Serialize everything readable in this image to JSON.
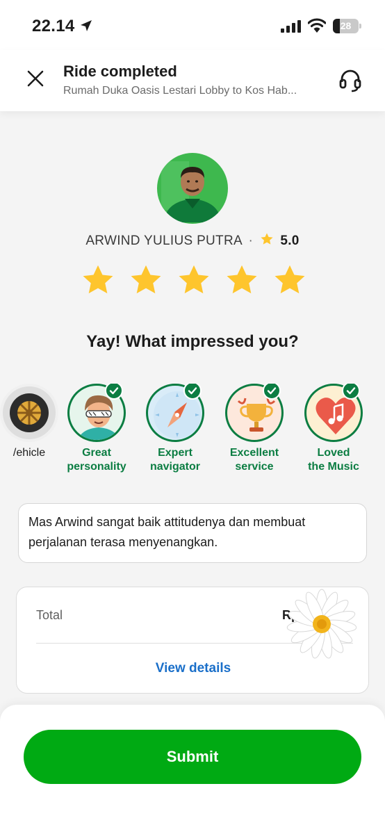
{
  "status_bar": {
    "time": "22.14",
    "battery_level": 28,
    "battery_text": "28"
  },
  "header": {
    "title": "Ride completed",
    "subtitle": "Rumah Duka Oasis Lestari Lobby to Kos Hab..."
  },
  "driver": {
    "name": "ARWIND YULIUS PUTRA",
    "separator": "·",
    "rating": "5.0",
    "user_rating": 5,
    "user_rating_max": 5
  },
  "compliments": {
    "question": "Yay! What impressed you?",
    "items": [
      {
        "label_line1": "/ehicle",
        "label_line2": "",
        "icon": "wheel-icon",
        "selected": false
      },
      {
        "label_line1": "Great",
        "label_line2": "personality",
        "icon": "cool-person-icon",
        "selected": true
      },
      {
        "label_line1": "Expert",
        "label_line2": "navigator",
        "icon": "compass-icon",
        "selected": true
      },
      {
        "label_line1": "Excellent",
        "label_line2": "service",
        "icon": "trophy-icon",
        "selected": true
      },
      {
        "label_line1": "Loved",
        "label_line2": "the Music",
        "icon": "music-heart-icon",
        "selected": true
      }
    ]
  },
  "comment": {
    "text": "Mas Arwind sangat baik attitudenya dan membuat perjalanan terasa menyenangkan."
  },
  "payment": {
    "total_label": "Total",
    "total_value": "Rp",
    "view_details": "View details"
  },
  "actions": {
    "submit_label": "Submit"
  },
  "colors": {
    "primary_green": "#00aa13",
    "dark_green": "#0b7d42",
    "star_yellow": "#fec52d",
    "link_blue": "#1a6fc9"
  }
}
